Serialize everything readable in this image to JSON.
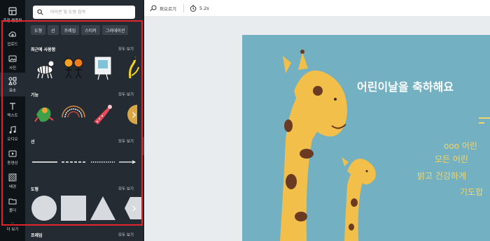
{
  "rail": {
    "items": [
      {
        "label": "추천 템플릿",
        "icon": "template-icon"
      },
      {
        "label": "업로드",
        "icon": "upload-icon"
      },
      {
        "label": "사진",
        "icon": "photo-icon"
      },
      {
        "label": "요소",
        "icon": "elements-icon"
      },
      {
        "label": "텍스트",
        "icon": "text-icon"
      },
      {
        "label": "오디오",
        "icon": "audio-icon"
      },
      {
        "label": "동영상",
        "icon": "video-icon"
      },
      {
        "label": "배경",
        "icon": "background-icon"
      },
      {
        "label": "폴더",
        "icon": "folder-icon"
      },
      {
        "label": "더 보기",
        "icon": "more-icon"
      }
    ]
  },
  "search": {
    "placeholder": "아이콘 및 도형 검색"
  },
  "chips": [
    "도형",
    "선",
    "프레임",
    "스티커",
    "그라데이션"
  ],
  "sections": {
    "recent": {
      "title": "최근에 사용함",
      "more": "모두 보기"
    },
    "features": {
      "title": "기능",
      "more": "모두 보기"
    },
    "lines": {
      "title": "선",
      "more": "모두 보기"
    },
    "shapes": {
      "title": "도형",
      "more": "모두 보기"
    },
    "frames": {
      "title": "프레임",
      "more": "모두 보기"
    }
  },
  "topbar": {
    "play_label": "펴오르기",
    "time_label": "5.2s"
  },
  "design": {
    "title": "어린이날을 축하해요",
    "line1": "ooo 어린",
    "line2": "모든 어린",
    "line3": "밝고 건강하게",
    "line4": "기도합",
    "colors": {
      "background": "#72b0c2",
      "accent": "#f3d66a",
      "highlight": "#e0252d"
    }
  }
}
